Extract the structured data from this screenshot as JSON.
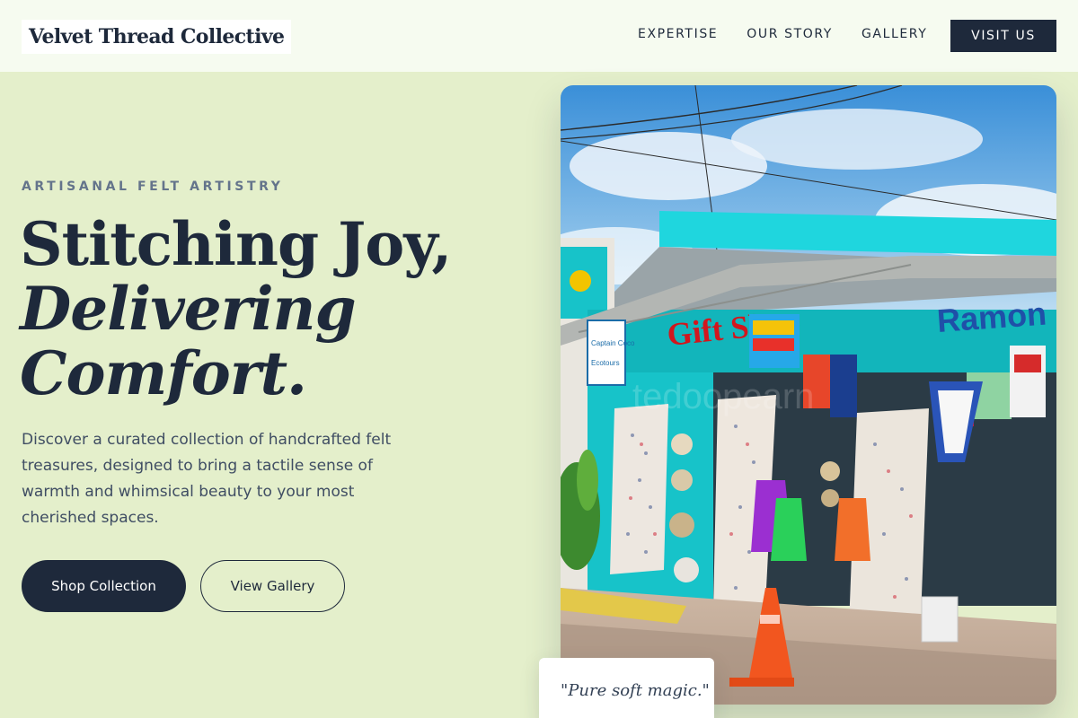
{
  "header": {
    "logo": "Velvet Thread Collective",
    "nav": [
      "EXPERTISE",
      "OUR STORY",
      "GALLERY"
    ],
    "cta": "VISIT US"
  },
  "hero": {
    "eyebrow": "ARTISANAL FELT ARTISTRY",
    "headline_line1": "Stitching Joy,",
    "headline_line2": "Delivering",
    "headline_line3": "Comfort.",
    "lede": "Discover a curated collection of handcrafted felt treasures, designed to bring a tactile sense of warmth and whimsical beauty to your most cherished spaces.",
    "primary_button": "Shop Collection",
    "secondary_button": "View Gallery"
  },
  "photo": {
    "signs": [
      "Gift Shop",
      "Ramon"
    ],
    "sign_small": [
      "Captain Coco",
      "Ecotours"
    ],
    "watermark": "tedoopearn"
  },
  "quote": "\"Pure soft magic.\"",
  "colors": {
    "background": "#e4efcb",
    "header_bg": "#f6fbf0",
    "navy": "#1e293b",
    "shop_turquoise": "#17c3c9"
  }
}
